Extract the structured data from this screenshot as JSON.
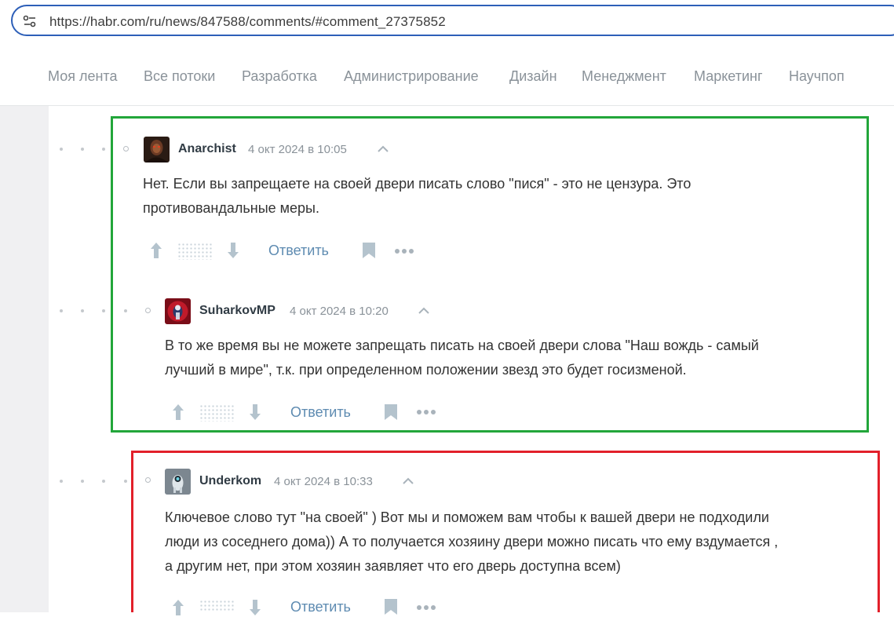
{
  "browser": {
    "url": "https://habr.com/ru/news/847588/comments/#comment_27375852"
  },
  "nav": {
    "items": [
      "Моя лента",
      "Все потоки",
      "Разработка",
      "Администрирование",
      "Дизайн",
      "Менеджмент",
      "Маркетинг",
      "Научпоп"
    ]
  },
  "comments": [
    {
      "author": "Anarchist",
      "time": "4 окт 2024 в 10:05",
      "lines": [
        "Нет. Если вы запрещаете на своей двери писать слово \"пися\" - это не цензура. Это",
        "противовандальные меры."
      ],
      "reply_label": "Ответить",
      "avatar_icon": "dark-figure-avatar"
    },
    {
      "author": "SuharkovMP",
      "time": "4 окт 2024 в 10:20",
      "lines": [
        "В то же время вы не можете запрещать писать на своей двери слова \"Наш вождь - самый",
        "лучший в мире\", т.к. при определенном положении звезд это будет госизменой."
      ],
      "reply_label": "Ответить",
      "avatar_icon": "red-character-avatar"
    },
    {
      "author": "Underkom",
      "time": "4 окт 2024 в 10:33",
      "lines": [
        "Ключевое слово тут \"на своей\" ) Вот мы и поможем вам чтобы к вашей двери не подходили",
        "люди из соседнего дома)) А то получается хозяину двери можно писать что ему вздумается ,",
        "а другим нет, при этом хозяин заявляет что его дверь доступна всем)"
      ],
      "reply_label": "Ответить",
      "avatar_icon": "robot-avatar"
    }
  ],
  "colors": {
    "highlight_green": "#22a63a",
    "highlight_red": "#e2202a",
    "link": "#5e8bb1"
  }
}
